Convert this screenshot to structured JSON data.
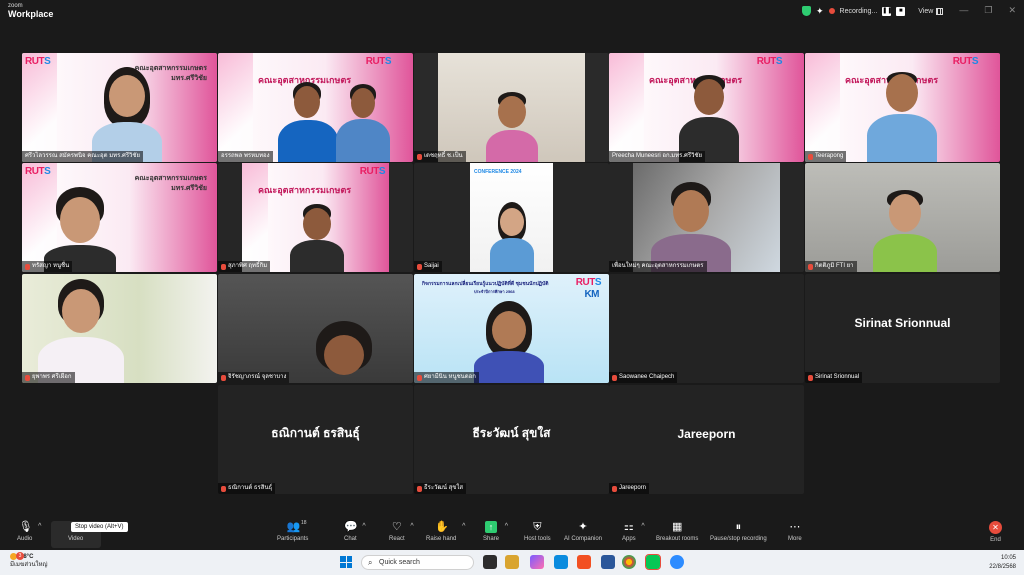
{
  "window": {
    "brand_line1": "zoom",
    "brand_line2": "Workplace",
    "recording_label": "Recording...",
    "view_label": "View"
  },
  "participants": [
    {
      "name": "ศรีวไลวรรณ สมัครพนิจ คณะอุต มทร.ศรีวิชัย",
      "muted": false,
      "active": true
    },
    {
      "name": "อรรถพล พรหมทอง",
      "muted": false
    },
    {
      "name": "เดชฤทธิ์ ช.เป็น",
      "muted": true
    },
    {
      "name": "Preecha Muneesri อก.มทร.ศรีวิชัย",
      "muted": false
    },
    {
      "name": "Teerapong",
      "muted": true
    },
    {
      "name": "ทรัสญา หนูชื่น",
      "muted": true
    },
    {
      "name": "สุภาพิศ ฤทธิ์กิม",
      "muted": true
    },
    {
      "name": "Saijai",
      "muted": true
    },
    {
      "name": "เพื่อนใหม่ๆ คณะอุตสาหกรรมเกษตร",
      "muted": false
    },
    {
      "name": "กิตติภูมิ FTI ยา",
      "muted": true
    },
    {
      "name": "ยุพาพร ศรีเผือก",
      "muted": true
    },
    {
      "name": "จิรัชญาภรณ์ จุลชาบาง",
      "muted": true
    },
    {
      "name": "ศยามีนิน หนูชนดอก",
      "muted": true
    },
    {
      "name": "Saowanee Chaipech",
      "muted": true,
      "video_off": true
    },
    {
      "name": "Sirinat Srionnual",
      "muted": true,
      "video_off": true
    },
    {
      "name": "ธณิกานต์ ธรสินธุ์",
      "muted": true,
      "video_off": true
    },
    {
      "name": "ธีระวัฒน์ สุขใส",
      "muted": true,
      "video_off": true
    },
    {
      "name": "Jareeporn",
      "muted": true,
      "video_off": true
    }
  ],
  "banners": {
    "faculty": "คณะอุตสาหกรรมเกษตร",
    "faculty_short": "มทร.ศรีวิชัย",
    "rut": "RUT",
    "s": "S",
    "conference": "CONFERENCE 2024",
    "activity": "กิจกรรมการแลกเปลี่ยนเรียนรู้แนวปฏิบัติที่ดี ชุมชนนักปฏิบัติ",
    "activity_sub": "ประจำปีการศึกษา 2568",
    "km": "KM"
  },
  "toolbar": {
    "audio": "Audio",
    "video": "Video",
    "tooltip": "Stop video (Alt+V)",
    "participants": "Participants",
    "participants_count": "18",
    "chat": "Chat",
    "react": "React",
    "raise_hand": "Raise hand",
    "share": "Share",
    "host_tools": "Host tools",
    "ai_companion": "AI Companion",
    "apps": "Apps",
    "breakout": "Breakout rooms",
    "pause_recording": "Pause/stop recording",
    "more": "More",
    "end": "End"
  },
  "taskbar": {
    "weather_badge": "3",
    "temperature": "28°C",
    "weather_text": "มีเมฆส่วนใหญ่",
    "search": "Quick search",
    "time": "10:05",
    "date": "22/8/2568"
  },
  "colors": {
    "accent_green": "#2ecc71",
    "end_red": "#e74c3c",
    "brand_pink": "#e91e63"
  }
}
